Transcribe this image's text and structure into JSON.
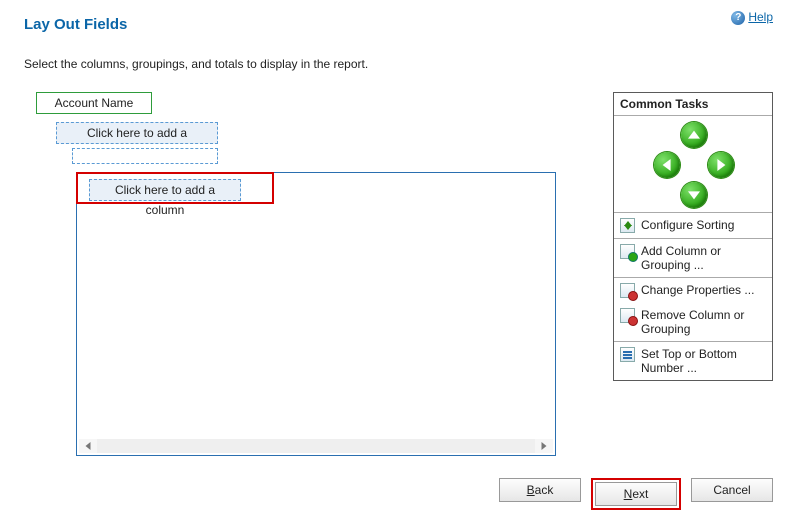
{
  "header": {
    "title": "Lay Out Fields",
    "help_label": "Help"
  },
  "instructions": "Select the columns, groupings, and totals to display in the report.",
  "layout": {
    "account_name_label": "Account Name",
    "add_grouping_label": "Click here to add a grouping",
    "add_column_label": "Click here to add a column"
  },
  "tasks": {
    "title": "Common Tasks",
    "configure_sorting": "Configure Sorting",
    "add_column": "Add Column or Grouping ...",
    "change_properties": "Change Properties ...",
    "remove_column": "Remove Column or Grouping",
    "set_top_bottom": "Set Top or Bottom Number ..."
  },
  "footer": {
    "back": "Back",
    "next": "Next",
    "cancel": "Cancel"
  }
}
